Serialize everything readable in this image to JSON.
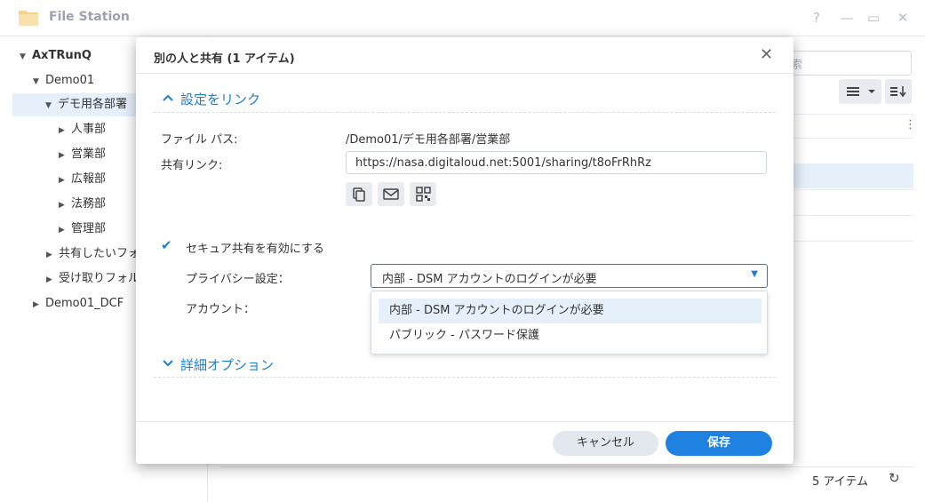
{
  "window": {
    "title": "File Station",
    "controls": [
      "?",
      "—",
      "▭",
      "✕"
    ]
  },
  "sidebar": {
    "items": [
      {
        "label": "AxTRunQ",
        "arrow": "▼"
      },
      {
        "label": "Demo01",
        "arrow": "▼"
      },
      {
        "label": "デモ用各部署",
        "arrow": "▼"
      },
      {
        "label": "人事部",
        "arrow": "▶"
      },
      {
        "label": "営業部",
        "arrow": "▶"
      },
      {
        "label": "広報部",
        "arrow": "▶"
      },
      {
        "label": "法務部",
        "arrow": "▶"
      },
      {
        "label": "管理部",
        "arrow": "▶"
      },
      {
        "label": "共有したいフォ",
        "arrow": "▶"
      },
      {
        "label": "受け取りフォル",
        "arrow": "▶"
      },
      {
        "label": "Demo01_DCF",
        "arrow": "▶"
      }
    ]
  },
  "main": {
    "search_placeholder": "索",
    "item_count": "5 アイテム",
    "more_icon": "⋮",
    "refresh_icon": "↻"
  },
  "modal": {
    "title": "別の人と共有 (1 アイテム)",
    "close": "✕",
    "section_link": {
      "chevron": "⌃",
      "label": "設定をリンク"
    },
    "file_path_label": "ファイル パス:",
    "file_path_value": "/Demo01/デモ用各部署/営業部",
    "share_link_label": "共有リンク:",
    "share_link_value": "https://nasa.digitaloud.net:5001/sharing/t8oFrRhRz",
    "secure_share_label": "セキュア共有を有効にする",
    "secure_share_checked": "✔",
    "privacy_label": "プライバシー設定：",
    "privacy_selected": "内部 - DSM アカウントのログインが必要",
    "privacy_caret": "▼",
    "privacy_options": [
      "内部 - DSM アカウントのログインが必要",
      "パブリック - パスワード保護"
    ],
    "account_label": "アカウント：",
    "section_advanced": {
      "chevron": "⌄",
      "label": "詳細オプション"
    },
    "cancel_label": "キャンセル",
    "save_label": "保存"
  },
  "colors": {
    "accent": "#1a7fd6",
    "save_button": "#1f82e0",
    "selection": "#e6f0fa"
  }
}
